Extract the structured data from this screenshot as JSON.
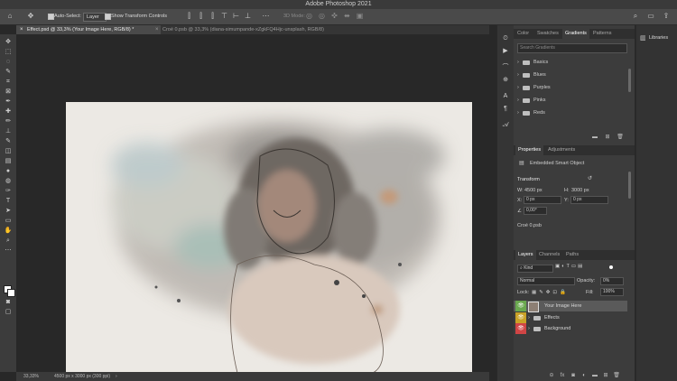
{
  "app": {
    "title": "Adobe Photoshop 2021"
  },
  "options_bar": {
    "auto_select_label": "Auto-Select:",
    "auto_select_target": "Layer",
    "show_transform_label": "Show Transform Controls",
    "mode_label": "3D Mode:"
  },
  "tabs": [
    {
      "label": "Effect.psd @ 33,3% (Your Image Here, RGB/8) *",
      "active": true
    },
    {
      "label": "Croé 0.psb @ 33,3% (diana-simumpande-xZgkFQ4Hjc-unsplash, RGB/8)",
      "active": false
    }
  ],
  "status": {
    "zoom": "33,33%",
    "doc_info": "4500 px x 3000 px (300 ppi)"
  },
  "gradients_panel": {
    "tabs": [
      "Color",
      "Swatches",
      "Gradients",
      "Patterns"
    ],
    "active_tab": "Gradients",
    "search_placeholder": "Search Gradients",
    "groups": [
      "Basics",
      "Blues",
      "Purples",
      "Pinks",
      "Reds"
    ]
  },
  "properties_panel": {
    "tabs": [
      "Properties",
      "Adjustments"
    ],
    "object_type": "Embedded Smart Object",
    "transform_label": "Transform",
    "w_label": "W:",
    "w_value": "4500 px",
    "h_label": "H:",
    "h_value": "3000 px",
    "x_label": "X:",
    "x_value": "0 px",
    "y_label": "Y:",
    "y_value": "0 px",
    "angle_value": "0,00°",
    "linked_file": "Croé 0.psb"
  },
  "layers_panel": {
    "tabs": [
      "Layers",
      "Channels",
      "Paths"
    ],
    "kind_label": "Kind",
    "blend_mode": "Normal",
    "opacity_label": "Opacity:",
    "opacity_value": "0%",
    "lock_label": "Lock:",
    "fill_label": "Fill:",
    "fill_value": "100%",
    "layers": [
      {
        "name": "Your Image Here",
        "eye_color": "#6aa84f",
        "selected": true
      },
      {
        "name": "Effects",
        "eye_color": "#c9a227",
        "selected": false
      },
      {
        "name": "Background",
        "eye_color": "#d04545",
        "selected": false
      }
    ]
  },
  "libraries": {
    "label": "Libraries"
  },
  "colors": {
    "accent": "#4b8fd6"
  }
}
